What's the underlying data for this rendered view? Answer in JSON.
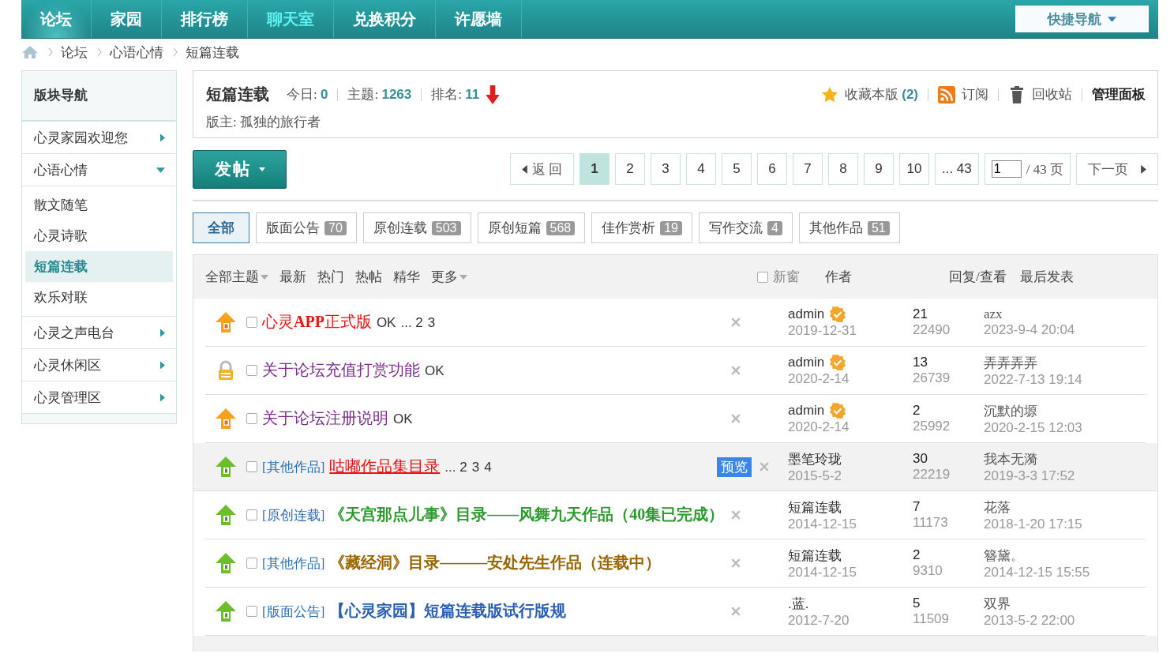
{
  "nav": {
    "items": [
      {
        "label": "论坛",
        "selected": true
      },
      {
        "label": "家园",
        "selected": false
      },
      {
        "label": "排行榜",
        "selected": false
      },
      {
        "label": "聊天室",
        "selected": false,
        "highlight": true
      },
      {
        "label": "兑换积分",
        "selected": false
      },
      {
        "label": "许愿墙",
        "selected": false
      }
    ],
    "quick_nav": "快捷导航"
  },
  "breadcrumb": [
    "论坛",
    "心语心情",
    "短篇连载"
  ],
  "sidebar": {
    "title": "版块导航",
    "items": [
      {
        "label": "心灵家园欢迎您",
        "expanded": false
      },
      {
        "label": "心语心情",
        "expanded": true,
        "children": [
          {
            "label": "散文随笔",
            "selected": false
          },
          {
            "label": "心灵诗歌",
            "selected": false
          },
          {
            "label": "短篇连载",
            "selected": true
          },
          {
            "label": "欢乐对联",
            "selected": false
          }
        ]
      },
      {
        "label": "心灵之声电台",
        "expanded": false
      },
      {
        "label": "心灵休闲区",
        "expanded": false
      },
      {
        "label": "心灵管理区",
        "expanded": false
      }
    ]
  },
  "forum": {
    "name": "短篇连载",
    "stats": [
      {
        "label": "今日:",
        "value": "0"
      },
      {
        "label": "主题:",
        "value": "1263"
      },
      {
        "label": "排名:",
        "value": "11"
      }
    ],
    "rank_down": true,
    "moderator": "版主: 孤独的旅行者",
    "favorite": "收藏本版",
    "favorite_count": "(2)",
    "subscribe": "订阅",
    "recycle": "回收站",
    "admin": "管理面板"
  },
  "post_button": "发帖",
  "pagination": {
    "back": "返 回",
    "pages": [
      {
        "label": "1",
        "selected": true
      },
      {
        "label": "2",
        "selected": false
      },
      {
        "label": "3",
        "selected": false
      },
      {
        "label": "4",
        "selected": false
      },
      {
        "label": "5",
        "selected": false
      },
      {
        "label": "6",
        "selected": false
      },
      {
        "label": "7",
        "selected": false
      },
      {
        "label": "8",
        "selected": false
      },
      {
        "label": "9",
        "selected": false
      },
      {
        "label": "10",
        "selected": false
      },
      {
        "label": "... 43",
        "selected": false
      }
    ],
    "page_input": "1",
    "total": "/ 43 页",
    "next": "下一页"
  },
  "categories": [
    {
      "label": "全部",
      "selected": true
    },
    {
      "label": "版面公告",
      "count": "70",
      "selected": false
    },
    {
      "label": "原创连载",
      "count": "503",
      "selected": false
    },
    {
      "label": "原创短篇",
      "count": "568",
      "selected": false
    },
    {
      "label": "佳作赏析",
      "count": "19",
      "selected": false
    },
    {
      "label": "写作交流",
      "count": "4",
      "selected": false
    },
    {
      "label": "其他作品",
      "count": "51",
      "selected": false
    }
  ],
  "list_header": {
    "filters": [
      {
        "label": "全部主题",
        "dropdown": true
      },
      {
        "label": "最新",
        "dropdown": false
      },
      {
        "label": "热门",
        "dropdown": false
      },
      {
        "label": "热帖",
        "dropdown": false
      },
      {
        "label": "精华",
        "dropdown": false
      },
      {
        "label": "更多",
        "dropdown": true
      }
    ],
    "new_window": "新窗",
    "new_window_checked": false,
    "author": "作者",
    "replies_views": "回复/查看",
    "last_post": "最后发表"
  },
  "rows": [
    {
      "kind": "pinned",
      "category": "",
      "title": "心灵**APP**正式版",
      "color": "#ee1111",
      "bold": false,
      "underline": false,
      "tag": "OK",
      "pages": [
        "... 2",
        "3"
      ],
      "preview": "",
      "author": "admin",
      "verified": true,
      "date": "2019-12-31",
      "replies": "21",
      "views": "22490",
      "last_user": "azx",
      "last_time": "2023-9-4 20:04",
      "highlighted": false
    },
    {
      "kind": "locked",
      "category": "",
      "title": "关于论坛充值打赏功能",
      "color": "#7a2d8c",
      "bold": false,
      "underline": false,
      "tag": "OK",
      "pages": [],
      "preview": "",
      "author": "admin",
      "verified": true,
      "date": "2020-2-14",
      "replies": "13",
      "views": "26739",
      "last_user": "弄弄弄弄",
      "last_time": "2022-7-13 19:14",
      "highlighted": false
    },
    {
      "kind": "pinned",
      "category": "",
      "title": "关于论坛注册说明",
      "color": "#7a2d8c",
      "bold": false,
      "underline": false,
      "tag": "OK",
      "pages": [],
      "preview": "",
      "author": "admin",
      "verified": true,
      "date": "2020-2-14",
      "replies": "2",
      "views": "25992",
      "last_user": "沉默的塬",
      "last_time": "2020-2-15 12:03",
      "highlighted": false
    },
    {
      "kind": "normal",
      "category": "[其他作品]",
      "title": "咕嘟作品集目录",
      "color": "#ee1111",
      "bold": false,
      "underline": true,
      "tag": "",
      "pages": [
        "... 2",
        "3",
        "4"
      ],
      "preview": "预览",
      "author": "墨笔玲珑",
      "verified": false,
      "date": "2015-5-2",
      "replies": "30",
      "views": "22219",
      "last_user": "我本无漪",
      "last_time": "2019-3-3 17:52",
      "highlighted": true
    },
    {
      "kind": "normal",
      "category": "[原创连载]",
      "title": "《天宫那点儿事》目录——风舞九天作品（40集已完成）",
      "color": "#2e9a2e",
      "bold": true,
      "underline": false,
      "tag": "",
      "pages": [],
      "preview": "",
      "author": "短篇连载",
      "verified": false,
      "date": "2014-12-15",
      "replies": "7",
      "views": "11173",
      "last_user": "花落",
      "last_time": "2018-1-20 17:15",
      "highlighted": false
    },
    {
      "kind": "normal",
      "category": "[其他作品]",
      "title": "《藏经洞》目录———安处先生作品（连载中）",
      "color": "#996600",
      "bold": true,
      "underline": false,
      "tag": "",
      "pages": [],
      "preview": "",
      "author": "短篇连载",
      "verified": false,
      "date": "2014-12-15",
      "replies": "2",
      "views": "9310",
      "last_user": "簪黛。",
      "last_time": "2014-12-15 15:55",
      "highlighted": false
    },
    {
      "kind": "normal",
      "category": "[版面公告]",
      "title": "【心灵家园】短篇连载版试行版规",
      "color": "#2b5fb3",
      "bold": true,
      "underline": false,
      "tag": "",
      "pages": [],
      "preview": "",
      "author": ".蓝.",
      "verified": false,
      "date": "2012-7-20",
      "replies": "5",
      "views": "11509",
      "last_user": "双界",
      "last_time": "2013-5-2 22:00",
      "highlighted": false
    }
  ]
}
